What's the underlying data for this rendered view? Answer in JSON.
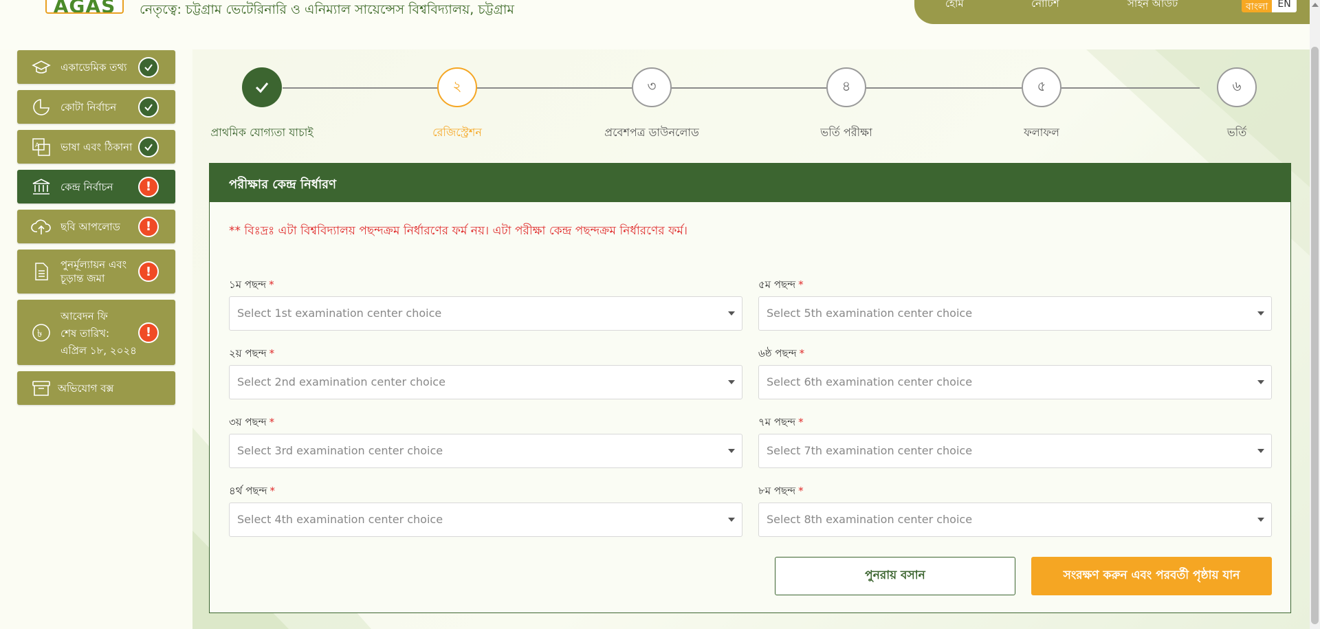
{
  "header": {
    "logo_text": "AGAS",
    "subtitle": "নেতৃত্বে: চট্টগ্রাম ভেটেরিনারি ও এনিম্যাল সায়েন্সেস বিশ্ববিদ্যালয়, চট্টগ্রাম",
    "nav": [
      "হোম",
      "নোটিশ",
      "সাইন আউট"
    ],
    "lang_bn": "বাংলা",
    "lang_en": "EN"
  },
  "sidebar": {
    "items": [
      {
        "label": "একাডেমিক তথ্য",
        "status": "done",
        "icon": "graduation-cap-icon"
      },
      {
        "label": "কোটা নির্বাচন",
        "status": "done",
        "icon": "pie-chart-icon"
      },
      {
        "label": "ভাষা এবং ঠিকানা",
        "status": "done",
        "icon": "language-icon"
      },
      {
        "label": "কেন্দ্র নির্বাচন",
        "status": "warn",
        "icon": "institution-icon"
      },
      {
        "label": "ছবি আপলোড",
        "status": "warn",
        "icon": "cloud-upload-icon"
      },
      {
        "label_line1": "পুনর্মূল্যায়ন এবং",
        "label_line2": "চূড়ান্ত জমা",
        "status": "warn",
        "icon": "document-icon"
      },
      {
        "label_line1": "আবেদন ফি",
        "label_line2": "শেষ তারিখ:",
        "label_line3": "এপ্রিল ১৮, ২০২৪",
        "status": "warn",
        "icon": "taka-icon"
      },
      {
        "label": "অভিযোগ বক্স",
        "icon": "archive-box-icon"
      }
    ],
    "warn_glyph": "!"
  },
  "stepper": {
    "steps": [
      {
        "number": "",
        "label": "প্রাথমিক যোগ্যতা যাচাই",
        "state": "done"
      },
      {
        "number": "২",
        "label": "রেজিস্ট্রেশন",
        "state": "current"
      },
      {
        "number": "৩",
        "label": "প্রবেশপত্র ডাউনলোড",
        "state": "todo"
      },
      {
        "number": "৪",
        "label": "ভর্তি পরীক্ষা",
        "state": "todo"
      },
      {
        "number": "৫",
        "label": "ফলাফল",
        "state": "todo"
      },
      {
        "number": "৬",
        "label": "ভর্তি",
        "state": "todo"
      }
    ]
  },
  "form": {
    "title": "পরীক্ষার কেন্দ্র নির্ধারণ",
    "notice": "** বিঃদ্রঃ এটা বিশ্ববিদ্যালয় পছন্দক্রম নির্ধারণের ফর্ম নয়। এটা পরীক্ষা কেন্দ্র পছন্দক্রম নির্ধারণের ফর্ম।",
    "required_mark": "*",
    "choices": [
      {
        "label": "১ম পছন্দ",
        "placeholder": "Select 1st examination center choice"
      },
      {
        "label": "২য় পছন্দ",
        "placeholder": "Select 2nd examination center choice"
      },
      {
        "label": "৩য় পছন্দ",
        "placeholder": "Select 3rd examination center choice"
      },
      {
        "label": "৪র্থ পছন্দ",
        "placeholder": "Select 4th examination center choice"
      },
      {
        "label": "৫ম পছন্দ",
        "placeholder": "Select 5th examination center choice"
      },
      {
        "label": "৬ষ্ঠ পছন্দ",
        "placeholder": "Select 6th examination center choice"
      },
      {
        "label": "৭ম পছন্দ",
        "placeholder": "Select 7th examination center choice"
      },
      {
        "label": "৮ম পছন্দ",
        "placeholder": "Select 8th examination center choice"
      }
    ],
    "reset_label": "পুনরায় বসান",
    "save_label": "সংরক্ষণ করুন এবং পরবর্তী পৃষ্ঠায় যান"
  },
  "colors": {
    "primary": "#3c6530",
    "olive": "#9a9a4a",
    "accent": "#f5a623",
    "warn": "#f04b25",
    "notice": "#e02b2b"
  }
}
